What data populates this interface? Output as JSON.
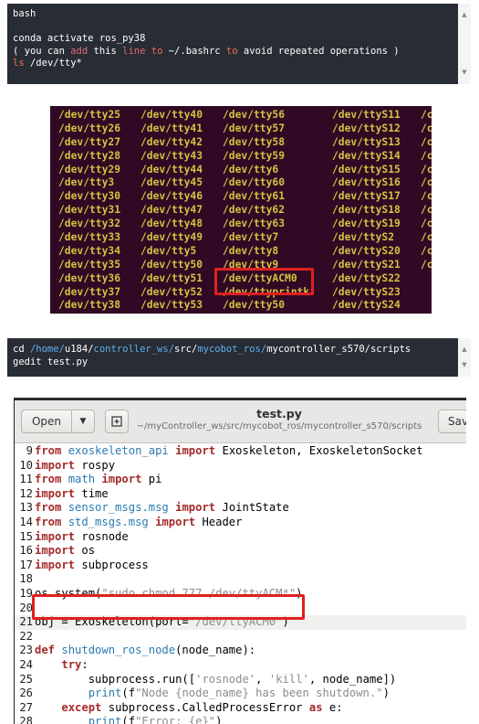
{
  "code_block_1": {
    "lines": [
      {
        "parts": [
          {
            "t": "bash",
            "c": ""
          }
        ]
      },
      {
        "parts": [
          {
            "t": "",
            "c": ""
          }
        ]
      },
      {
        "parts": [
          {
            "t": "conda activate ros_py38",
            "c": ""
          }
        ]
      },
      {
        "parts": [
          {
            "t": "( you can ",
            "c": ""
          },
          {
            "t": "add",
            "c": "kw-orange"
          },
          {
            "t": " this ",
            "c": ""
          },
          {
            "t": "line",
            "c": "kw-orange"
          },
          {
            "t": " ",
            "c": ""
          },
          {
            "t": "to",
            "c": "kw-red"
          },
          {
            "t": " ~/.bashrc ",
            "c": ""
          },
          {
            "t": "to",
            "c": "kw-red"
          },
          {
            "t": " avoid repeated operations )",
            "c": ""
          }
        ]
      },
      {
        "parts": [
          {
            "t": "ls",
            "c": "kw-red"
          },
          {
            "t": " /dev/tty*",
            "c": ""
          }
        ]
      }
    ]
  },
  "terminal": {
    "columns": [
      [
        "/dev/tty25",
        "/dev/tty26",
        "/dev/tty27",
        "/dev/tty28",
        "/dev/tty29",
        "/dev/tty3",
        "/dev/tty30",
        "/dev/tty31",
        "/dev/tty32",
        "/dev/tty33",
        "/dev/tty34",
        "/dev/tty35",
        "/dev/tty36",
        "/dev/tty37",
        "/dev/tty38"
      ],
      [
        "/dev/tty40",
        "/dev/tty41",
        "/dev/tty42",
        "/dev/tty43",
        "/dev/tty44",
        "/dev/tty45",
        "/dev/tty46",
        "/dev/tty47",
        "/dev/tty48",
        "/dev/tty49",
        "/dev/tty5",
        "/dev/tty50",
        "/dev/tty51",
        "/dev/tty52",
        "/dev/tty53"
      ],
      [
        "/dev/tty56",
        "/dev/tty57",
        "/dev/tty58",
        "/dev/tty59",
        "/dev/tty6",
        "/dev/tty60",
        "/dev/tty61",
        "/dev/tty62",
        "/dev/tty63",
        "/dev/tty7",
        "/dev/tty8",
        "/dev/tty9",
        "/dev/ttyACM0",
        "/dev/ttyprintk",
        "/dev/tty50"
      ],
      [
        "/dev/ttyS11",
        "/dev/ttyS12",
        "/dev/ttyS13",
        "/dev/ttyS14",
        "/dev/ttyS15",
        "/dev/ttyS16",
        "/dev/ttyS17",
        "/dev/ttyS18",
        "/dev/ttyS19",
        "/dev/ttyS2",
        "/dev/ttyS20",
        "/dev/ttyS21",
        "/dev/ttyS22",
        "/dev/ttyS23",
        "/dev/ttyS24"
      ],
      [
        "/c",
        "/c",
        "/c",
        "/c",
        "/c",
        "/c",
        "/c",
        "/c",
        "/c",
        "/c",
        "/c",
        "/c",
        "",
        "",
        ""
      ]
    ]
  },
  "code_block_2": {
    "lines": [
      {
        "parts": [
          {
            "t": "cd ",
            "c": ""
          },
          {
            "t": "/home/",
            "c": "path-blue"
          },
          {
            "t": "u184/",
            "c": ""
          },
          {
            "t": "controller_ws/",
            "c": "path-blue"
          },
          {
            "t": "src/",
            "c": ""
          },
          {
            "t": "mycobot_ros/",
            "c": "path-blue"
          },
          {
            "t": "mycontroller_s570/scripts",
            "c": ""
          }
        ]
      },
      {
        "parts": [
          {
            "t": "gedit test.py",
            "c": ""
          }
        ]
      }
    ]
  },
  "gedit": {
    "open_label": "Open",
    "open_arrow": "▼",
    "new_tab_icon": "⊞",
    "title": "test.py",
    "subtitle": "~/myController_ws/src/mycobot_ros/mycontroller_s570/scripts",
    "save_label": "Save",
    "lines": [
      {
        "n": "9",
        "parts": [
          {
            "t": "from",
            "c": "k-brown"
          },
          {
            "t": " exoskeleton_api ",
            "c": "k-fn"
          },
          {
            "t": "import",
            "c": "k-brown"
          },
          {
            "t": " Exoskeleton, ExoskeletonSocket",
            "c": ""
          }
        ]
      },
      {
        "n": "10",
        "parts": [
          {
            "t": "import",
            "c": "k-brown"
          },
          {
            "t": " rospy",
            "c": ""
          }
        ]
      },
      {
        "n": "11",
        "parts": [
          {
            "t": "from",
            "c": "k-brown"
          },
          {
            "t": " math ",
            "c": "k-fn"
          },
          {
            "t": "import",
            "c": "k-brown"
          },
          {
            "t": " pi",
            "c": ""
          }
        ]
      },
      {
        "n": "12",
        "parts": [
          {
            "t": "import",
            "c": "k-brown"
          },
          {
            "t": " time",
            "c": ""
          }
        ]
      },
      {
        "n": "13",
        "parts": [
          {
            "t": "from",
            "c": "k-brown"
          },
          {
            "t": " sensor_msgs.msg ",
            "c": "k-fn"
          },
          {
            "t": "import",
            "c": "k-brown"
          },
          {
            "t": " JointState",
            "c": ""
          }
        ]
      },
      {
        "n": "14",
        "parts": [
          {
            "t": "from",
            "c": "k-brown"
          },
          {
            "t": " std_msgs.msg ",
            "c": "k-fn"
          },
          {
            "t": "import",
            "c": "k-brown"
          },
          {
            "t": " Header",
            "c": ""
          }
        ]
      },
      {
        "n": "15",
        "parts": [
          {
            "t": "import",
            "c": "k-brown"
          },
          {
            "t": " rosnode",
            "c": ""
          }
        ]
      },
      {
        "n": "16",
        "parts": [
          {
            "t": "import",
            "c": "k-brown"
          },
          {
            "t": " os",
            "c": ""
          }
        ]
      },
      {
        "n": "17",
        "parts": [
          {
            "t": "import",
            "c": "k-brown"
          },
          {
            "t": " subprocess",
            "c": ""
          }
        ]
      },
      {
        "n": "18",
        "parts": [
          {
            "t": "",
            "c": ""
          }
        ]
      },
      {
        "n": "19",
        "parts": [
          {
            "t": "os.system(",
            "c": ""
          },
          {
            "t": "\"sudo chmod 777 /dev/ttyACM*\"",
            "c": "k-str"
          },
          {
            "t": ")",
            "c": ""
          }
        ]
      },
      {
        "n": "20",
        "parts": [
          {
            "t": "",
            "c": ""
          }
        ]
      },
      {
        "n": "21",
        "parts": [
          {
            "t": "obj = Exoskeleton(port=",
            "c": ""
          },
          {
            "t": "\"/dev/ttyACM0\"",
            "c": "k-str"
          },
          {
            "t": ")",
            "c": ""
          }
        ]
      },
      {
        "n": "22",
        "parts": [
          {
            "t": "",
            "c": ""
          }
        ]
      },
      {
        "n": "23",
        "parts": [
          {
            "t": "def",
            "c": "k-kw"
          },
          {
            "t": " shutdown_ros_node",
            "c": "k-fn"
          },
          {
            "t": "(node_name):",
            "c": ""
          }
        ]
      },
      {
        "n": "24",
        "parts": [
          {
            "t": "    ",
            "c": ""
          },
          {
            "t": "try",
            "c": "k-kw"
          },
          {
            "t": ":",
            "c": ""
          }
        ]
      },
      {
        "n": "25",
        "parts": [
          {
            "t": "        subprocess.run([",
            "c": ""
          },
          {
            "t": "'rosnode'",
            "c": "k-str"
          },
          {
            "t": ", ",
            "c": ""
          },
          {
            "t": "'kill'",
            "c": "k-str"
          },
          {
            "t": ", node_name])",
            "c": ""
          }
        ]
      },
      {
        "n": "26",
        "parts": [
          {
            "t": "        ",
            "c": ""
          },
          {
            "t": "print",
            "c": "k-fn"
          },
          {
            "t": "(f",
            "c": ""
          },
          {
            "t": "\"Node {node_name} has been shutdown.\"",
            "c": "k-str"
          },
          {
            "t": ")",
            "c": ""
          }
        ]
      },
      {
        "n": "27",
        "parts": [
          {
            "t": "    ",
            "c": ""
          },
          {
            "t": "except",
            "c": "k-kw"
          },
          {
            "t": " subprocess.CalledProcessError ",
            "c": ""
          },
          {
            "t": "as",
            "c": "k-kw"
          },
          {
            "t": " e:",
            "c": ""
          }
        ]
      },
      {
        "n": "28",
        "parts": [
          {
            "t": "        ",
            "c": ""
          },
          {
            "t": "print",
            "c": "k-fn"
          },
          {
            "t": "(f",
            "c": ""
          },
          {
            "t": "\"Error: {e}\"",
            "c": "k-str"
          },
          {
            "t": ")",
            "c": ""
          }
        ]
      }
    ]
  },
  "colors": {
    "code_bg": "#282c34",
    "terminal_bg": "#300a24",
    "terminal_text": "#d7c042",
    "highlight_red": "#e02020"
  }
}
